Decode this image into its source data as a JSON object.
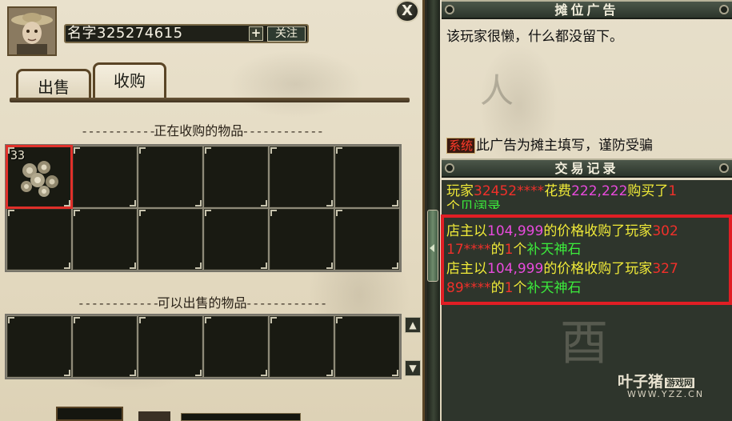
{
  "shop": {
    "owner_name": "名字325274615",
    "follow_label": "关注",
    "add_label": "+",
    "close_label": "X",
    "tabs": [
      {
        "label": "出售",
        "active": false
      },
      {
        "label": "收购",
        "active": true
      }
    ],
    "buying_section_title": "正在收购的物品",
    "sellable_section_title": "可以出售的物品",
    "buying_items": [
      {
        "slot": 0,
        "count": "33",
        "icon": "stone-stack-icon",
        "selected": true
      }
    ],
    "scroll_up_icon": "scroll-up-icon",
    "scroll_down_icon": "scroll-down-icon"
  },
  "ad_panel": {
    "header": "摊位广告",
    "message": "该玩家很懒，什么都没留下。",
    "system_tag": "系统",
    "warning": "此广告为摊主填写，谨防受骗"
  },
  "trade_log": {
    "header": "交易记录",
    "entries": [
      {
        "line1": [
          {
            "text": "玩家",
            "color": "yellow"
          },
          {
            "text": "32452****",
            "color": "red"
          },
          {
            "text": "花费",
            "color": "yellow"
          },
          {
            "text": "222,222",
            "color": "magenta"
          },
          {
            "text": "购买了",
            "color": "yellow"
          },
          {
            "text": "1",
            "color": "red"
          }
        ],
        "line2": [
          {
            "text": "个",
            "color": "yellow"
          },
          {
            "text": "贝阔录",
            "color": "green"
          }
        ]
      },
      {
        "line1": [
          {
            "text": "店主以",
            "color": "yellow"
          },
          {
            "text": "104,999",
            "color": "magenta"
          },
          {
            "text": "的价格收购了玩家",
            "color": "yellow"
          },
          {
            "text": "302",
            "color": "red"
          }
        ],
        "line2": [
          {
            "text": "17****",
            "color": "red"
          },
          {
            "text": "的",
            "color": "yellow"
          },
          {
            "text": "1",
            "color": "red"
          },
          {
            "text": "个",
            "color": "yellow"
          },
          {
            "text": "补天神石",
            "color": "green"
          }
        ]
      },
      {
        "line1": [
          {
            "text": "店主以",
            "color": "yellow"
          },
          {
            "text": "104,999",
            "color": "magenta"
          },
          {
            "text": "的价格收购了玩家",
            "color": "yellow"
          },
          {
            "text": "327",
            "color": "red"
          }
        ],
        "line2": [
          {
            "text": "89****",
            "color": "red"
          },
          {
            "text": "的",
            "color": "yellow"
          },
          {
            "text": "1",
            "color": "red"
          },
          {
            "text": "个",
            "color": "yellow"
          },
          {
            "text": "补天神石",
            "color": "green"
          }
        ]
      }
    ]
  },
  "watermark": {
    "brand": "叶子猪",
    "tag": "游戏网",
    "url": "WWW.YZZ.CN"
  },
  "colors": {
    "yellow": "#f0ea38",
    "red": "#f0302a",
    "magenta": "#e84adc",
    "green": "#3cec3c",
    "highlight": "#e01e24"
  }
}
